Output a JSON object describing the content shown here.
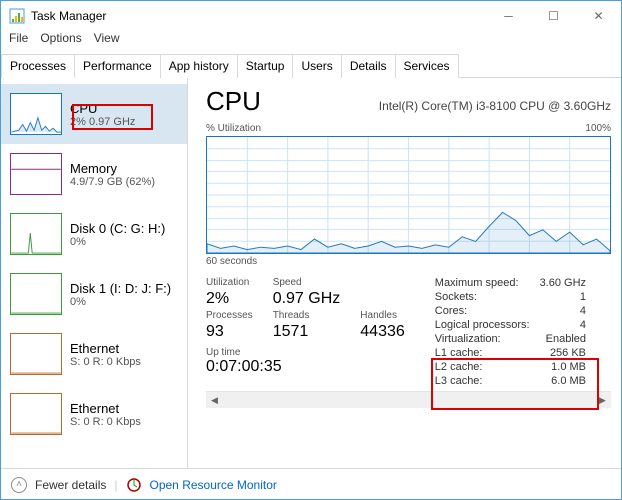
{
  "window": {
    "title": "Task Manager"
  },
  "menu": {
    "file": "File",
    "options": "Options",
    "view": "View"
  },
  "tabs": {
    "processes": "Processes",
    "performance": "Performance",
    "apphistory": "App history",
    "startup": "Startup",
    "users": "Users",
    "details": "Details",
    "services": "Services"
  },
  "sidebar": {
    "cpu": {
      "title": "CPU",
      "sub": "2% 0.97 GHz",
      "color": "#1376c8"
    },
    "memory": {
      "title": "Memory",
      "sub": "4.9/7.9 GB (62%)",
      "color": "#8b2a8b"
    },
    "disk0": {
      "title": "Disk 0 (C: G: H:)",
      "sub": "0%",
      "color": "#3a9b3a"
    },
    "disk1": {
      "title": "Disk 1 (I: D: J: F:)",
      "sub": "0%",
      "color": "#3a9b3a"
    },
    "eth0": {
      "title": "Ethernet",
      "sub": "S: 0 R: 0 Kbps",
      "color": "#b86b2b"
    },
    "eth1": {
      "title": "Ethernet",
      "sub": "S: 0 R: 0 Kbps",
      "color": "#b86b2b"
    }
  },
  "cpu": {
    "title": "CPU",
    "model": "Intel(R) Core(TM) i3-8100 CPU @ 3.60GHz",
    "chart_top_left": "% Utilization",
    "chart_top_right": "100%",
    "chart_bottom_left": "60 seconds",
    "labels": {
      "utilization": "Utilization",
      "speed": "Speed",
      "processes": "Processes",
      "threads": "Threads",
      "handles": "Handles",
      "uptime": "Up time",
      "maxspeed": "Maximum speed:",
      "sockets": "Sockets:",
      "cores": "Cores:",
      "logical": "Logical processors:",
      "virtualization": "Virtualization:",
      "l1": "L1 cache:",
      "l2": "L2 cache:",
      "l3": "L3 cache:"
    },
    "values": {
      "utilization": "2%",
      "speed": "0.97 GHz",
      "processes": "93",
      "threads": "1571",
      "handles": "44336",
      "uptime": "0:07:00:35",
      "maxspeed": "3.60 GHz",
      "sockets": "1",
      "cores": "4",
      "logical": "4",
      "virtualization": "Enabled",
      "l1": "256 KB",
      "l2": "1.0 MB",
      "l3": "6.0 MB"
    }
  },
  "footer": {
    "fewer": "Fewer details",
    "orm": "Open Resource Monitor"
  },
  "chart_data": {
    "type": "line",
    "title": "% Utilization",
    "xlabel": "60 seconds",
    "ylabel": "% Utilization",
    "ylim": [
      0,
      100
    ],
    "x_seconds_ago": [
      60,
      58,
      56,
      54,
      52,
      50,
      48,
      46,
      44,
      42,
      40,
      38,
      36,
      34,
      32,
      30,
      28,
      26,
      24,
      22,
      20,
      18,
      16,
      14,
      12,
      10,
      8,
      6,
      4,
      2,
      0
    ],
    "values": [
      8,
      4,
      6,
      3,
      5,
      4,
      6,
      3,
      12,
      5,
      8,
      4,
      6,
      10,
      5,
      6,
      4,
      7,
      5,
      14,
      10,
      23,
      35,
      28,
      15,
      20,
      10,
      18,
      7,
      12,
      2
    ]
  }
}
